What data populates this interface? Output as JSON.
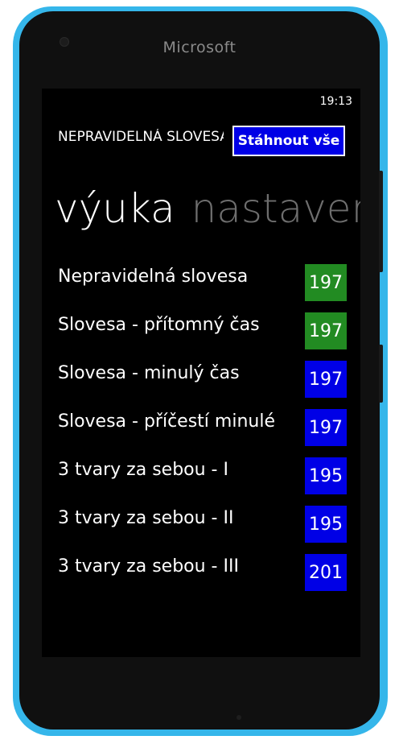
{
  "device": {
    "brand": "Microsoft"
  },
  "status_bar": {
    "time": "19:13"
  },
  "header": {
    "title": "NEPRAVIDELNÁ SLOVESA",
    "download_button": "Stáhnout vše"
  },
  "pivot": {
    "tabs": [
      {
        "label": "výuka",
        "active": true
      },
      {
        "label": "nastavení",
        "active": false
      }
    ]
  },
  "colors": {
    "completed": "#228b22",
    "pending": "#0000e6",
    "frame": "#35b6ea"
  },
  "lessons": [
    {
      "label": "Nepravidelná slovesa",
      "count": "197",
      "status": "completed"
    },
    {
      "label": "Slovesa - přítomný čas",
      "count": "197",
      "status": "completed"
    },
    {
      "label": "Slovesa - minulý čas",
      "count": "197",
      "status": "pending"
    },
    {
      "label": "Slovesa - příčestí minulé",
      "count": "197",
      "status": "pending"
    },
    {
      "label": "3 tvary za sebou - I",
      "count": "195",
      "status": "pending"
    },
    {
      "label": "3 tvary za sebou - II",
      "count": "195",
      "status": "pending"
    },
    {
      "label": "3 tvary za sebou - III",
      "count": "201",
      "status": "pending"
    }
  ]
}
